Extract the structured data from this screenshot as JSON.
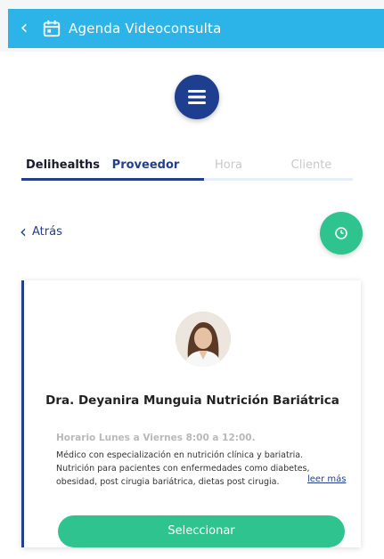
{
  "header": {
    "title": "Agenda Videoconsulta",
    "back_icon": "chevron-left-icon",
    "calendar_icon": "calendar-icon",
    "background_color": "#2cb4e8"
  },
  "menu_button": {
    "icon": "menu-icon",
    "color": "#1e3f8f"
  },
  "tabs": [
    {
      "label": "Delihealths"
    },
    {
      "label": "Proveedor"
    },
    {
      "label": "Hora"
    },
    {
      "label": "Cliente"
    }
  ],
  "tabs_progress": 0.55,
  "nav": {
    "back_label": "Atrás",
    "fab_icon": "clock-icon",
    "fab_color": "#2fc390"
  },
  "provider": {
    "name": "Dra. Deyanira Munguia Nutrición Bariátrica",
    "schedule": "Horario Lunes a Viernes 8:00 a 12:00.",
    "description": "Médico con especialización en nutrición clínica y bariatria. Nutrición para pacientes con enfermedades como diabetes, obesidad, post cirugia bariátrica, dietas post cirugia.",
    "read_more": "leer más",
    "select_label": "Seleccionar"
  }
}
